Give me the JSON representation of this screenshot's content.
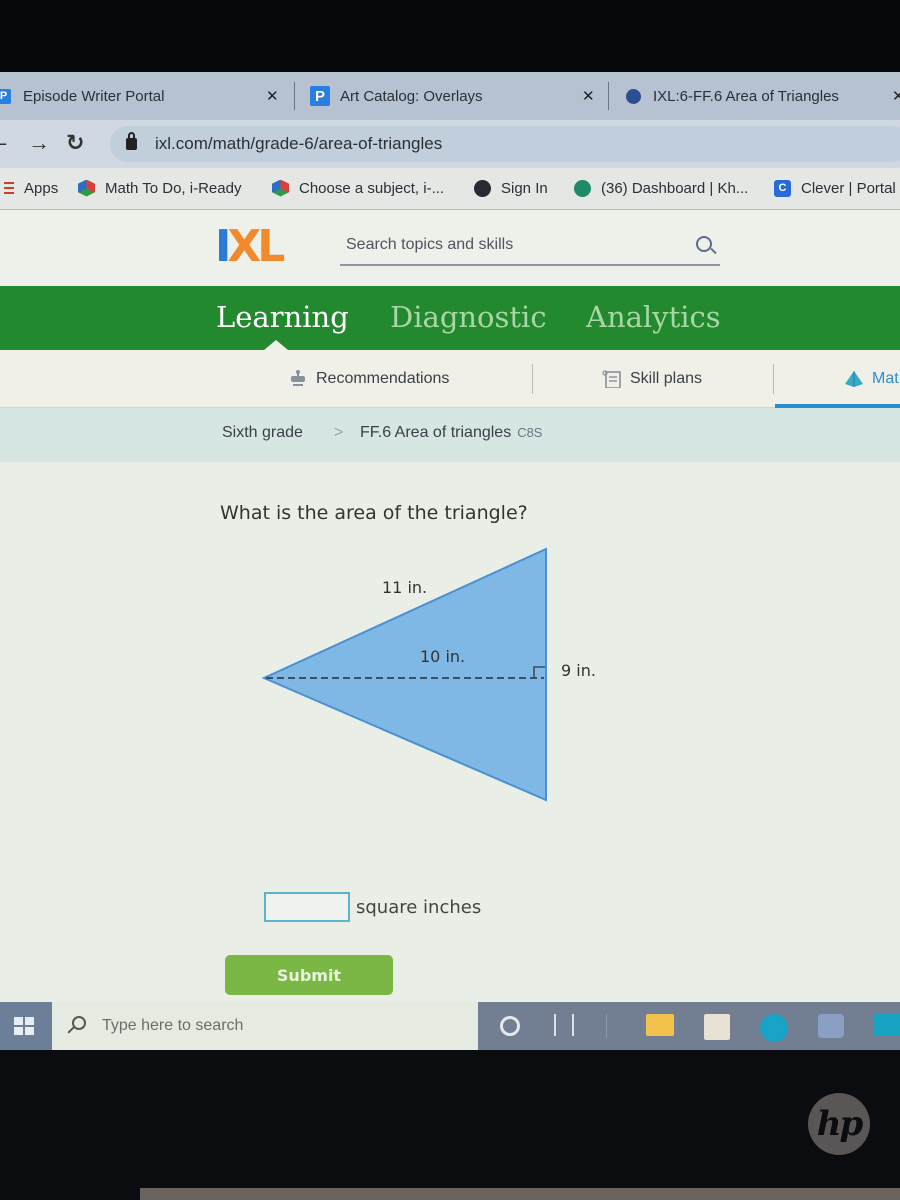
{
  "browser": {
    "tabs": [
      {
        "title": "Episode Writer Portal",
        "icon": "p-icon",
        "active": false
      },
      {
        "title": "Art Catalog: Overlays",
        "icon": "p-icon",
        "active": false
      },
      {
        "title": "IXL:6-FF.6 Area of Triangles",
        "icon": "ixl-icon",
        "active": true
      }
    ],
    "close_glyph": "✕",
    "url": "ixl.com/math/grade-6/area-of-triangles",
    "bookmarks": [
      {
        "label": "Apps",
        "icon": "apps-grid-icon"
      },
      {
        "label": "Math To Do, i-Ready",
        "icon": "iready-cube-icon"
      },
      {
        "label": "Choose a subject, i-...",
        "icon": "iready-cube-icon"
      },
      {
        "label": "Sign In",
        "icon": "globe-icon"
      },
      {
        "label": "(36) Dashboard | Kh...",
        "icon": "khan-academy-icon"
      },
      {
        "label": "Clever | Portal",
        "icon": "clever-icon",
        "icon_letter": "C"
      }
    ]
  },
  "ixl": {
    "logo": {
      "i": "I",
      "xl": "XL"
    },
    "search_placeholder": "Search topics and skills",
    "main_nav": [
      {
        "label": "Learning",
        "active": true
      },
      {
        "label": "Diagnostic",
        "active": false
      },
      {
        "label": "Analytics",
        "active": false
      }
    ],
    "sub_nav": [
      {
        "label": "Recommendations",
        "icon": "recommendations-icon"
      },
      {
        "label": "Skill plans",
        "icon": "skill-plans-icon"
      },
      {
        "label": "Mat",
        "icon": "pyramid-icon",
        "active": true
      }
    ],
    "breadcrumb": {
      "grade": "Sixth grade",
      "separator": ">",
      "skill": "FF.6 Area of triangles",
      "code": "C8S"
    },
    "question": "What is the area of the triangle?",
    "diagram": {
      "slant_side_label": "11 in.",
      "height_label": "10 in.",
      "base_label": "9 in."
    },
    "answer": {
      "value": "",
      "unit": "square inches"
    },
    "submit_label": "Submit"
  },
  "taskbar": {
    "search_placeholder": "Type here to search",
    "icons": [
      "cortana-icon",
      "task-view-icon",
      "file-explorer-icon",
      "microsoft-store-icon",
      "edge-icon",
      "teams-icon",
      "mail-icon"
    ]
  },
  "device": {
    "brand": "hp"
  },
  "colors": {
    "ixl_green": "#23892e",
    "ixl_blue": "#2b7ad4",
    "ixl_orange": "#f08a2c",
    "triangle_fill": "#7fb8e4",
    "triangle_stroke": "#4a90d4",
    "submit_green": "#7ab744",
    "active_underline": "#2a8fcf"
  }
}
